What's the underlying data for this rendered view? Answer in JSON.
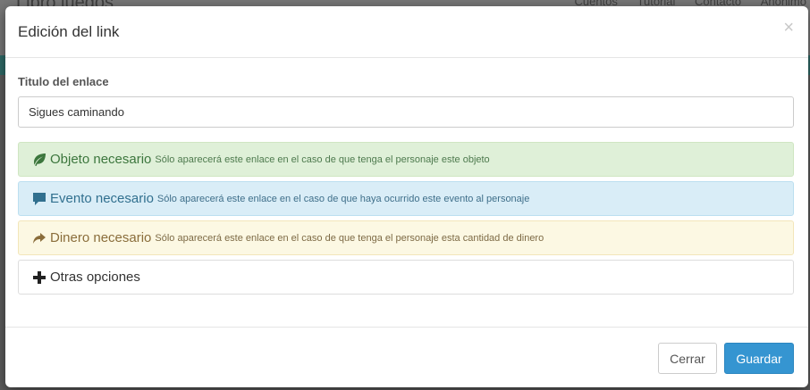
{
  "background": {
    "brand": "Libro juegos",
    "nav_links": [
      "Cuentos",
      "Tutorial",
      "Contacto",
      "Anonimo"
    ]
  },
  "modal": {
    "title": "Edición del link",
    "close_symbol": "×",
    "field": {
      "label": "Titulo del enlace",
      "value": "Sigues caminando"
    },
    "panels": [
      {
        "icon": "leaf-icon",
        "title": "Objeto necesario",
        "desc": "Sólo aparecerá este enlace en el caso de que tenga el personaje este objeto"
      },
      {
        "icon": "comment-icon",
        "title": "Evento necesario",
        "desc": "Sólo aparecerá este enlace en el caso de que haya ocurrido este evento al personaje"
      },
      {
        "icon": "share-icon",
        "title": "Dinero necesario",
        "desc": "Sólo aparecerá este enlace en el caso de que tenga el personaje esta cantidad de dinero"
      },
      {
        "icon": "plus-icon",
        "title": "Otras opciones",
        "desc": ""
      }
    ],
    "footer": {
      "close_label": "Cerrar",
      "save_label": "Guardar"
    }
  },
  "colors": {
    "success": "#3c763d",
    "info": "#31708f",
    "warning": "#8a6d3b",
    "primary": "#3595d1"
  }
}
